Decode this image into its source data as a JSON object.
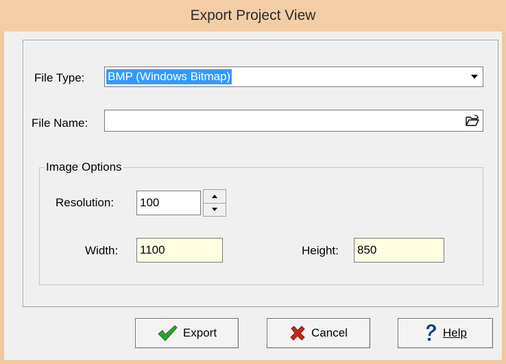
{
  "window": {
    "title": "Export Project View"
  },
  "form": {
    "file_type_label": "File Type:",
    "file_type_value": "BMP (Windows Bitmap)",
    "file_name_label": "File Name:",
    "file_name_value": ""
  },
  "image_options": {
    "group_label": "Image Options",
    "resolution_label": "Resolution:",
    "resolution_value": "100",
    "width_label": "Width:",
    "width_value": "1100",
    "height_label": "Height:",
    "height_value": "850"
  },
  "buttons": {
    "export_label": "Export",
    "cancel_label": "Cancel",
    "help_label": "Help"
  },
  "icons": {
    "file_type_dropdown": "chevron-down-icon",
    "browse": "open-folder-icon",
    "spin_up": "triangle-up-icon",
    "spin_down": "triangle-down-icon",
    "export": "checkmark-icon",
    "cancel": "x-icon",
    "help": "question-mark-icon"
  },
  "colors": {
    "title_bar": "#f3cda6",
    "selection": "#3399ff",
    "readonly_field": "#ffffe1",
    "export_icon": "#2ea12e",
    "cancel_icon": "#c0281e",
    "help_icon": "#1a3d8f"
  }
}
